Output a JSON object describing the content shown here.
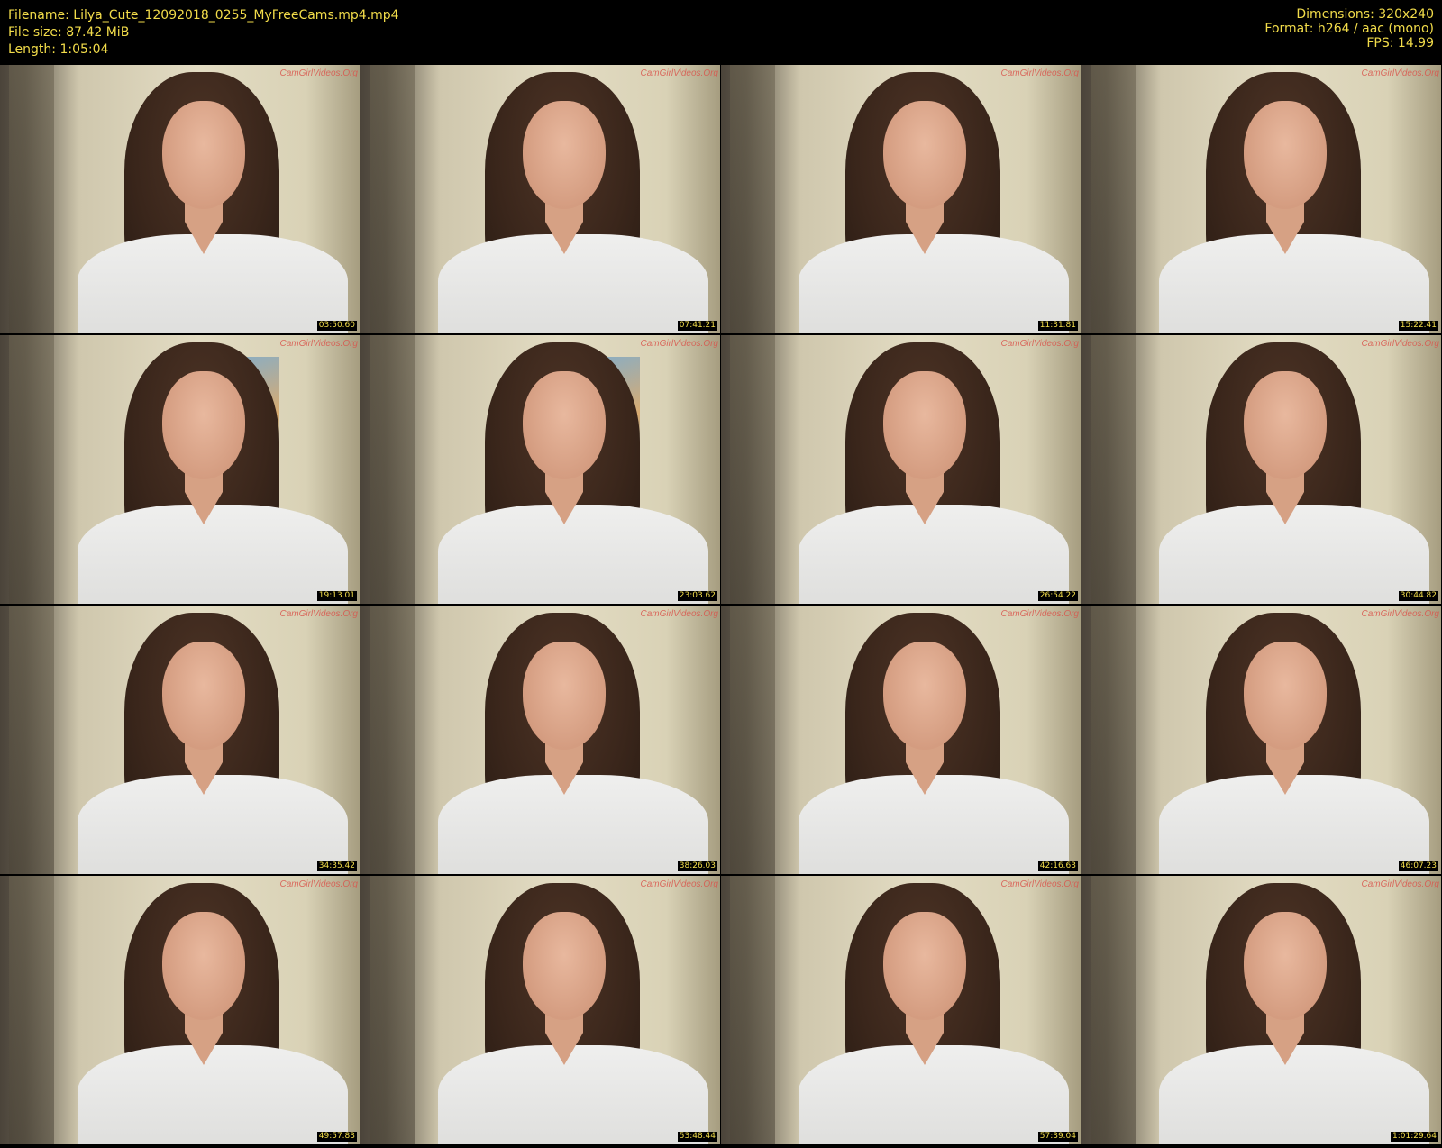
{
  "header": {
    "filename_line": "Filename: Lilya_Cute_12092018_0255_MyFreeCams.mp4.mp4",
    "filesize_line": "File size: 87.42 MiB",
    "length_line": "Length: 1:05:04",
    "dimensions_line": "Dimensions: 320x240",
    "format_line": "Format: h264 / aac (mono)",
    "fps_line": "FPS: 14.99"
  },
  "colors": {
    "text": "#f2dc4a",
    "background": "#000000",
    "watermark": "#d9574e"
  },
  "watermark": "CamGirlVideos.Org",
  "thumbnails": [
    {
      "timestamp": "03:50.60"
    },
    {
      "timestamp": "07:41.21"
    },
    {
      "timestamp": "11:31.81"
    },
    {
      "timestamp": "15:22.41"
    },
    {
      "timestamp": "19:13.01"
    },
    {
      "timestamp": "23:03.62"
    },
    {
      "timestamp": "26:54.22"
    },
    {
      "timestamp": "30:44.82"
    },
    {
      "timestamp": "34:35.42"
    },
    {
      "timestamp": "38:26.03"
    },
    {
      "timestamp": "42:16.63"
    },
    {
      "timestamp": "46:07.23"
    },
    {
      "timestamp": "49:57.83"
    },
    {
      "timestamp": "53:48.44"
    },
    {
      "timestamp": "57:39.04"
    },
    {
      "timestamp": "1:01:29.64"
    }
  ]
}
